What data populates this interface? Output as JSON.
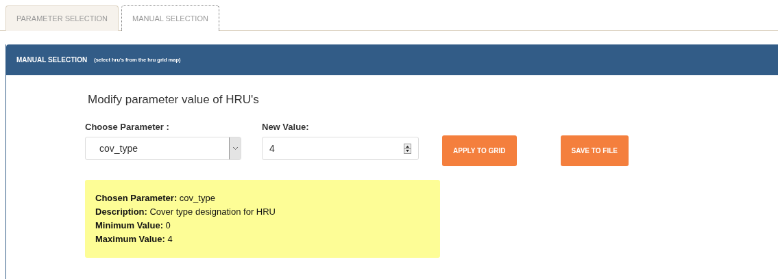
{
  "tabs": [
    {
      "label": "PARAMETER SELECTION",
      "selected": false
    },
    {
      "label": "MANUAL SELECTION",
      "selected": true
    }
  ],
  "panel": {
    "title": "MANUAL SELECTION",
    "subtitle": "(select hru's from the hru grid map)",
    "heading": "Modify parameter value of HRU's",
    "parameter_label": "Choose Parameter :",
    "parameter_value": "cov_type",
    "value_label": "New Value:",
    "value": "4",
    "buttons": [
      "APPLY TO GRID",
      "SAVE TO FILE"
    ],
    "info": [
      "**Chosen Parameter:**  cov_type",
      "**Description:**  Cover type designation for HRU",
      "**Minimum Value:**  0",
      "**Maximum Value:**  4"
    ]
  }
}
